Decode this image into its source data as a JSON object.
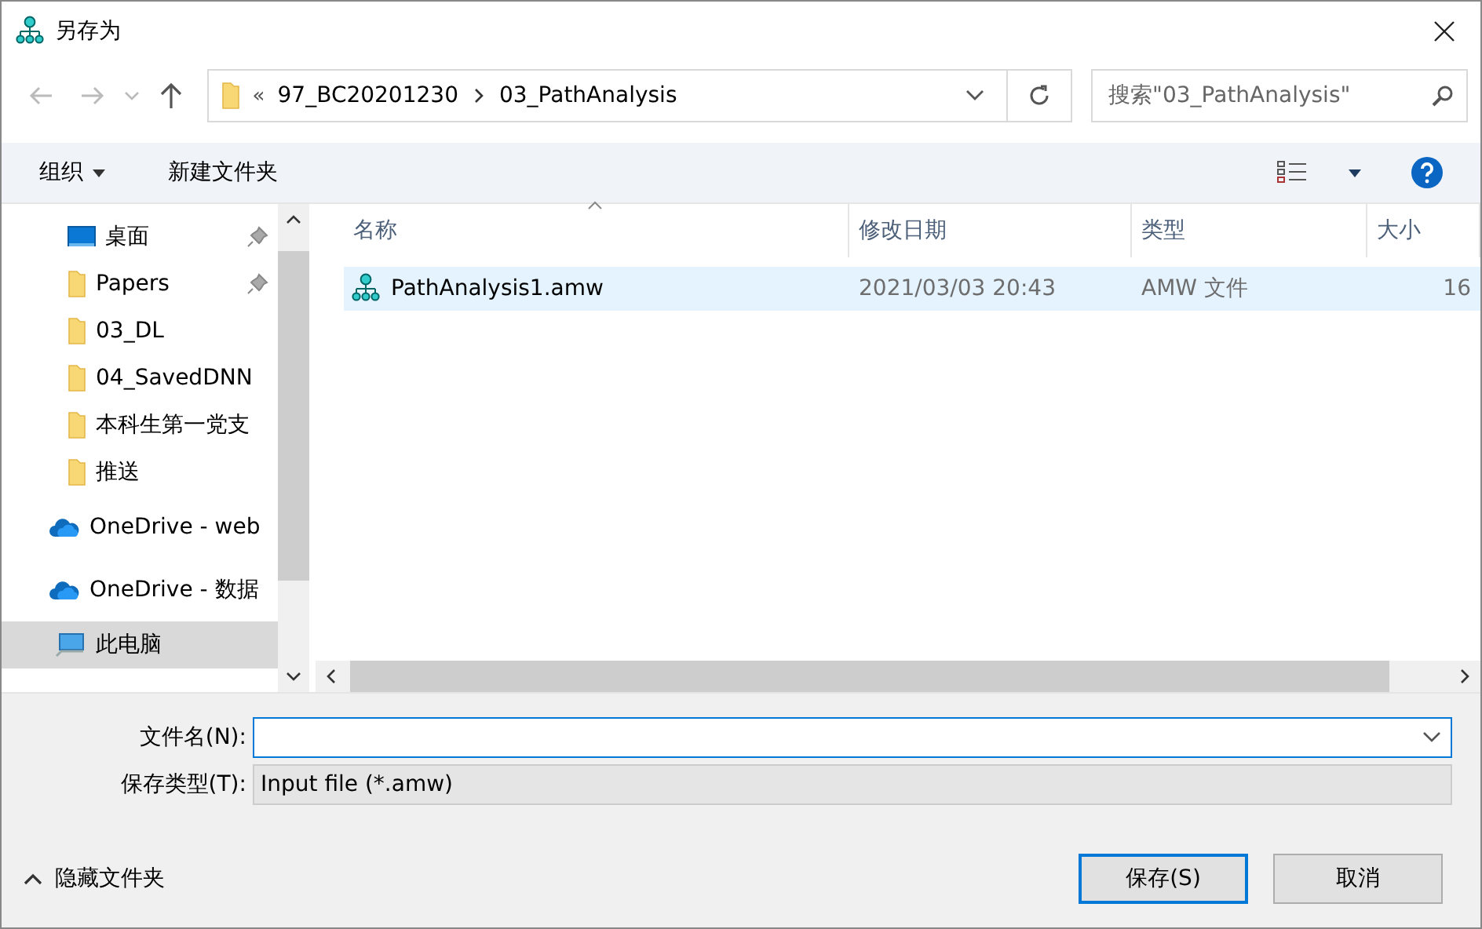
{
  "window": {
    "title": "另存为"
  },
  "address": {
    "overflow": "«",
    "path": [
      "97_BC20201230",
      "03_PathAnalysis"
    ]
  },
  "search": {
    "placeholder": "搜索\"03_PathAnalysis\""
  },
  "toolbar": {
    "organize": "组织",
    "new_folder": "新建文件夹"
  },
  "sidebar": {
    "items": [
      {
        "kind": "desktop",
        "label": "桌面",
        "pinned": true,
        "selected": false
      },
      {
        "kind": "folder",
        "label": "Papers",
        "pinned": true,
        "selected": false
      },
      {
        "kind": "folder",
        "label": "03_DL",
        "pinned": false,
        "selected": false
      },
      {
        "kind": "folder",
        "label": "04_SavedDNN",
        "pinned": false,
        "selected": false
      },
      {
        "kind": "folder",
        "label": "本科生第一党支",
        "pinned": false,
        "selected": false
      },
      {
        "kind": "folder",
        "label": "推送",
        "pinned": false,
        "selected": false
      },
      {
        "kind": "cloud",
        "label": "OneDrive - web",
        "pinned": false,
        "selected": false
      },
      {
        "kind": "cloud",
        "label": "OneDrive - 数据",
        "pinned": false,
        "selected": false
      },
      {
        "kind": "pc",
        "label": "此电脑",
        "pinned": false,
        "selected": true
      }
    ]
  },
  "table": {
    "columns": [
      "名称",
      "修改日期",
      "类型",
      "大小"
    ],
    "rows": [
      {
        "name": "PathAnalysis1.amw",
        "modified": "2021/03/03 20:43",
        "type": "AMW 文件",
        "size": "16",
        "selected": true
      }
    ]
  },
  "form": {
    "filename_label": "文件名(N):",
    "filetype_label": "保存类型(T):",
    "filetype_value": "Input file (*.amw)"
  },
  "footer": {
    "hide_folders": "隐藏文件夹",
    "buttons": [
      {
        "label": "保存(S)",
        "default": true
      },
      {
        "label": "取消",
        "default": false
      }
    ]
  }
}
